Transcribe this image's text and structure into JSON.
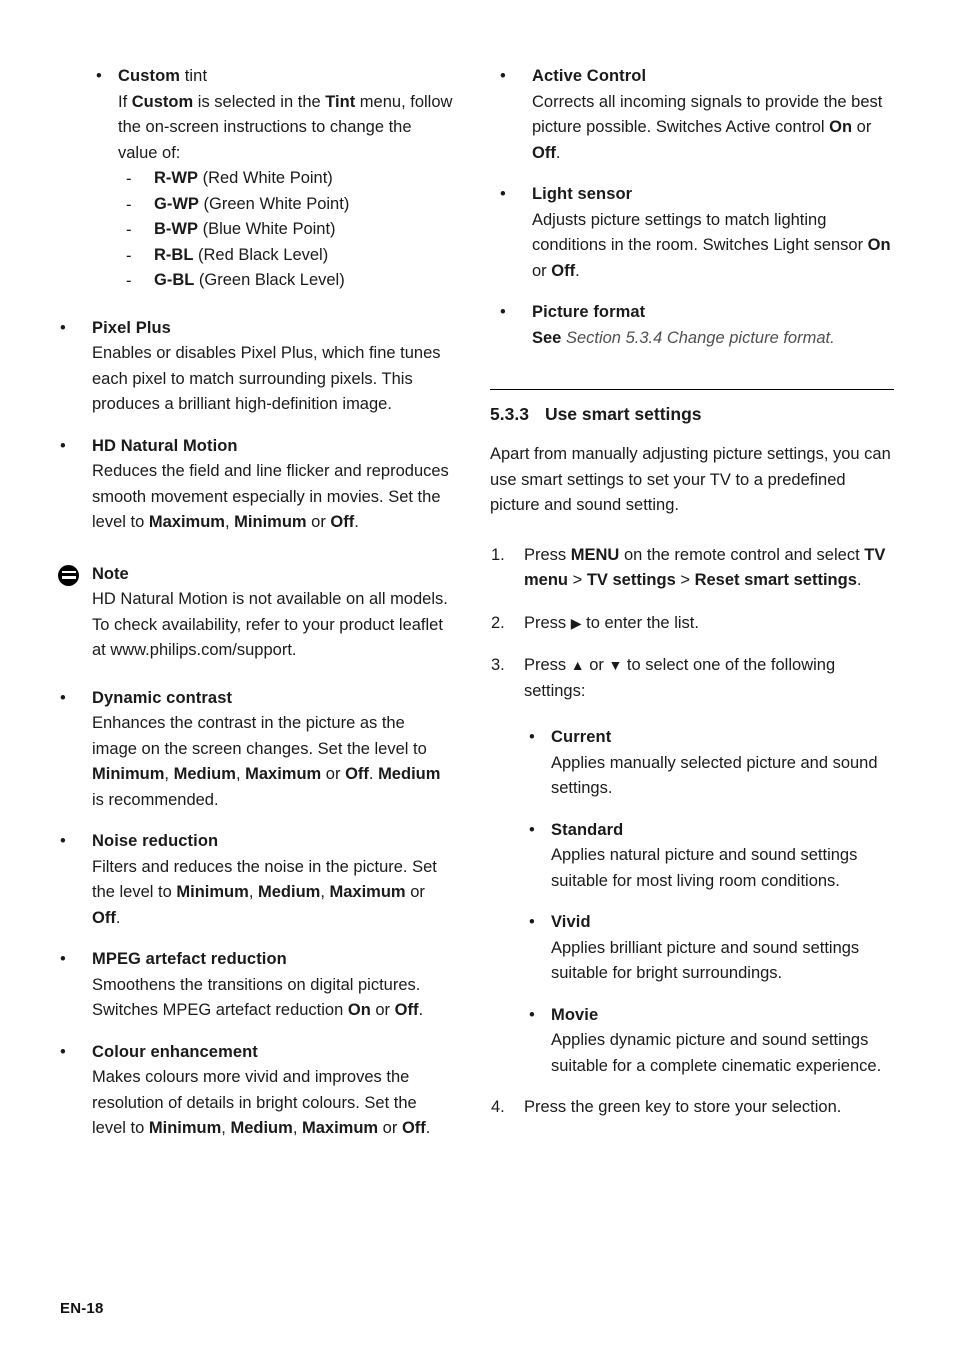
{
  "page": {
    "footer_label": "EN-18"
  },
  "left_column": {
    "custom_tint": {
      "marker": "•",
      "heading_bold": "Custom",
      "heading_rest": " tint",
      "body_prefix": "If ",
      "body_b1": "Custom",
      "body_mid": " is selected in the ",
      "body_b2": "Tint",
      "body_suffix": " menu, follow the on-screen instructions to change the value of:",
      "sub_items": [
        {
          "marker": "-",
          "code": "R-WP",
          "desc": " (Red White Point)"
        },
        {
          "marker": "-",
          "code": "G-WP",
          "desc": " (Green White Point)"
        },
        {
          "marker": "-",
          "code": "B-WP",
          "desc": " (Blue White Point)"
        },
        {
          "marker": "-",
          "code": "R-BL",
          "desc": " (Red Black Level)"
        },
        {
          "marker": "-",
          "code": "G-BL",
          "desc": " (Green Black Level)"
        }
      ]
    },
    "pixel_plus": {
      "marker": "•",
      "heading": "Pixel Plus",
      "body": "Enables or disables Pixel Plus, which fine tunes each pixel to match surrounding pixels. This produces a brilliant high-definition image."
    },
    "hd_natural_motion": {
      "marker": "•",
      "heading": "HD Natural Motion",
      "body_prefix": "Reduces the field and line flicker and reproduces smooth movement especially in movies. Set the level to ",
      "b1": "Maximum",
      "mid1": ", ",
      "b2": "Minimum",
      "mid2": " or ",
      "b3": "Off",
      "suffix": "."
    },
    "note": {
      "icon": "note-icon",
      "title": "Note",
      "body": "HD Natural Motion is not available on all models. To check availability, refer to your product leaflet at www.philips.com/support."
    },
    "dynamic_contrast": {
      "marker": "•",
      "heading": "Dynamic contrast",
      "body_prefix": "Enhances the contrast in the picture as the image on the screen changes. Set the level to ",
      "b1": "Minimum",
      "mid1": ", ",
      "b2": "Medium",
      "mid2": ", ",
      "b3": "Maximum",
      "mid3": " or ",
      "b4": "Off",
      "mid4": ". ",
      "b5": "Medium",
      "suffix": " is recommended."
    },
    "noise_reduction": {
      "marker": "•",
      "heading": "Noise reduction",
      "body_prefix": "Filters and reduces the noise in the picture. Set the level to ",
      "b1": "Minimum",
      "mid1": ", ",
      "b2": "Medium",
      "mid2": ", ",
      "b3": "Maximum",
      "mid3": " or ",
      "b4": "Off",
      "suffix": "."
    },
    "mpeg_artefact_reduction": {
      "marker": "•",
      "heading": "MPEG artefact reduction",
      "body_prefix": "Smoothens the transitions on digital pictures. Switches MPEG artefact reduction ",
      "b1": "On",
      "mid1": " or ",
      "b2": "Off",
      "suffix": "."
    },
    "colour_enhancement": {
      "marker": "•",
      "heading": "Colour enhancement",
      "body_prefix": "Makes colours more vivid and improves the resolution of details in bright colours. Set the level to ",
      "b1": "Minimum",
      "mid1": ", ",
      "b2": "Medium",
      "mid2": ", ",
      "b3": "Maximum",
      "mid3": " or ",
      "b4": "Off",
      "suffix": "."
    }
  },
  "right_column": {
    "active_control": {
      "marker": "•",
      "heading": "Active Control",
      "body_prefix": "Corrects all incoming signals to provide the best picture possible. Switches Active control ",
      "b1": "On",
      "mid1": " or ",
      "b2": "Off",
      "suffix": "."
    },
    "light_sensor": {
      "marker": "•",
      "heading": "Light sensor",
      "body_prefix": "Adjusts picture settings to match lighting conditions in the room. Switches Light sensor ",
      "b1": "On",
      "mid1": " or ",
      "b2": "Off",
      "suffix": "."
    },
    "picture_format": {
      "marker": "•",
      "heading": "Picture format",
      "see_bold": "See",
      "reference": " Section 5.3.4 Change picture format",
      "period": "."
    },
    "section": {
      "number": "5.3.3",
      "title": "Use smart settings",
      "intro": "Apart from manually adjusting picture settings, you can use smart settings to set your TV to a predefined picture and sound setting."
    },
    "steps": {
      "step1": {
        "marker": "1.",
        "prefix": "Press ",
        "b1": "MENU",
        "mid1": " on the remote control and select ",
        "b2": "TV menu",
        "mid2": " > ",
        "b3": "TV settings",
        "mid3": " > ",
        "b4": "Reset smart settings",
        "suffix": "."
      },
      "step2": {
        "marker": "2.",
        "prefix": "Press ",
        "arrow_right": "▶",
        "suffix": " to enter the list."
      },
      "step3": {
        "marker": "3.",
        "prefix": "Press ",
        "arrow_up": "▲",
        "mid": " or ",
        "arrow_down": "▼",
        "suffix": " to select one of the following settings:"
      },
      "step4": {
        "marker": "4.",
        "text": "Press the green key to store your selection."
      }
    },
    "smart_settings": [
      {
        "marker": "•",
        "heading": "Current",
        "body": "Applies manually selected picture and sound settings."
      },
      {
        "marker": "•",
        "heading": "Standard",
        "body": "Applies natural picture and sound settings suitable for most living room conditions."
      },
      {
        "marker": "•",
        "heading": "Vivid",
        "body": "Applies brilliant picture and sound settings suitable for bright surroundings."
      },
      {
        "marker": "•",
        "heading": "Movie",
        "body": "Applies dynamic picture and sound settings suitable for a complete cinematic experience."
      }
    ]
  }
}
